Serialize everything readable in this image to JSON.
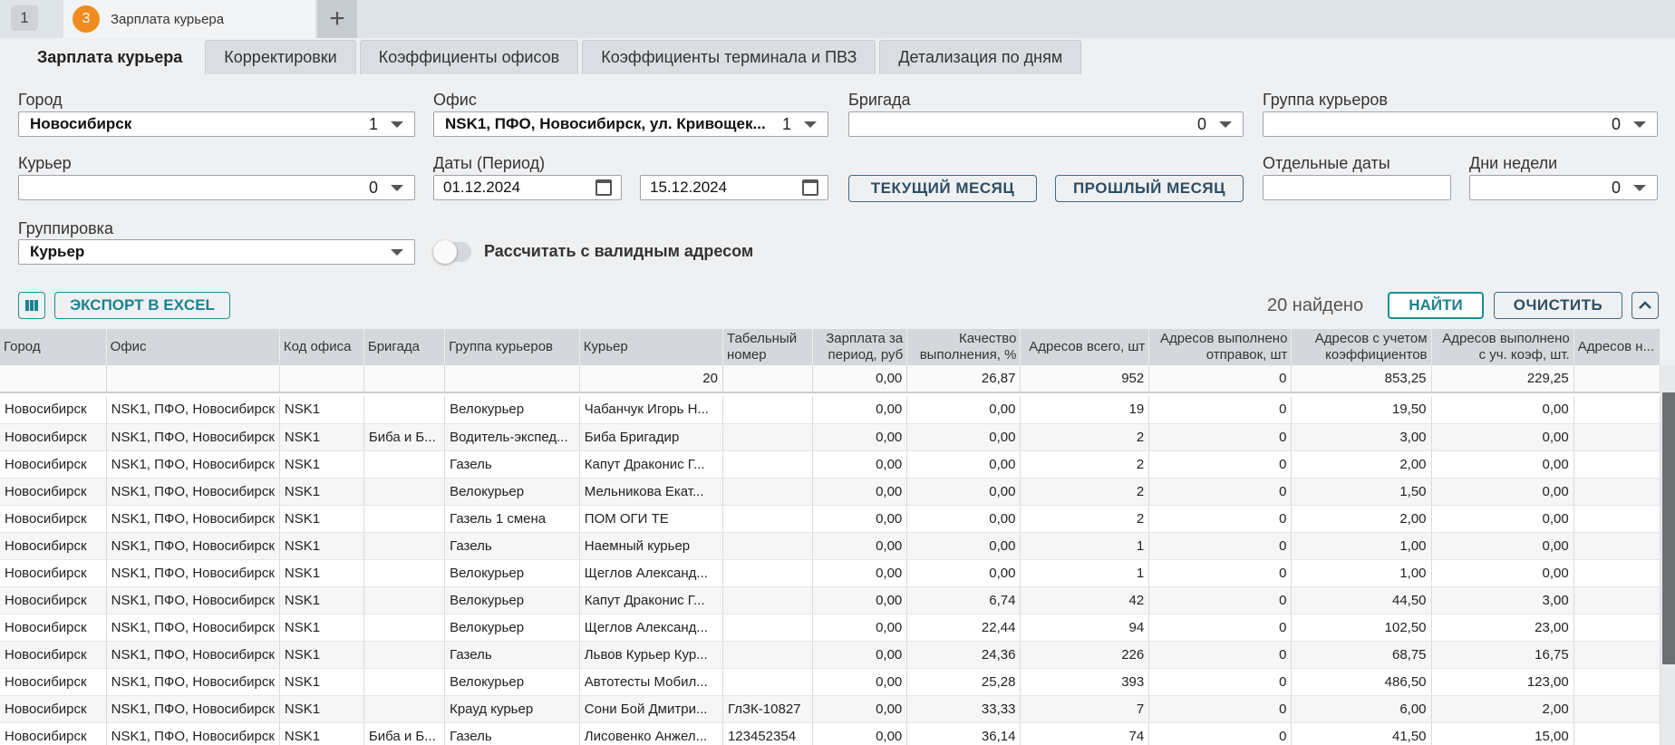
{
  "window_tabs": [
    {
      "label": "1"
    },
    {
      "badge": "3",
      "label": "Зарплата курьера"
    }
  ],
  "add_tab_label": "+",
  "sub_tabs": [
    "Зарплата курьера",
    "Корректировки",
    "Коэффициенты офисов",
    "Коэффициенты терминала и ПВЗ",
    "Детализация по дням"
  ],
  "filters": {
    "city": {
      "label": "Город",
      "value": "Новосибирск",
      "count": "1"
    },
    "office": {
      "label": "Офис",
      "value": "NSK1, ПФО, Новосибирск, ул. Кривощек...",
      "count": "1"
    },
    "brigade": {
      "label": "Бригада",
      "value": "",
      "count": "0"
    },
    "courier_group": {
      "label": "Группа курьеров",
      "value": "",
      "count": "0"
    },
    "courier": {
      "label": "Курьер",
      "value": "",
      "count": "0"
    },
    "dates": {
      "label": "Даты (Период)",
      "from": "01.12.2024",
      "to": "15.12.2024"
    },
    "current_month": "ТЕКУЩИЙ МЕСЯЦ",
    "last_month": "ПРОШЛЫЙ МЕСЯЦ",
    "separate_dates": {
      "label": "Отдельные даты",
      "value": ""
    },
    "weekdays": {
      "label": "Дни недели",
      "count": "0"
    },
    "grouping": {
      "label": "Группировка",
      "value": "Курьер"
    },
    "valid_address": {
      "label": "Рассчитать с валидным адресом",
      "on": false
    }
  },
  "toolbar": {
    "columns_icon": "columns-icon",
    "export": "ЭКСПОРТ В EXCEL",
    "found": "20 найдено",
    "find": "НАЙТИ",
    "clear": "ОЧИСТИТЬ",
    "collapse_icon": "chevron-up-icon"
  },
  "table": {
    "headers": [
      "Город",
      "Офис",
      "Код офиса",
      "Бригада",
      "Группа курьеров",
      "Курьер",
      "Табельный номер",
      "Зарплата за период, руб",
      "Качество выполнения, %",
      "Адресов всего, шт",
      "Адресов выполнено отправок, шт",
      "Адресов с учетом коэффициентов",
      "Адресов выполнено с уч. коэф, шт.",
      "Адресов н..."
    ],
    "total": [
      "",
      "",
      "",
      "",
      "",
      "20",
      "",
      "0,00",
      "26,87",
      "952",
      "0",
      "853,25",
      "229,25",
      ""
    ],
    "rows": [
      [
        "Новосибирск",
        "NSK1, ПФО, Новосибирск",
        "NSK1",
        "",
        "Велокурьер",
        "Чабанчук Игорь Н...",
        "",
        "0,00",
        "0,00",
        "19",
        "0",
        "19,50",
        "0,00",
        ""
      ],
      [
        "Новосибирск",
        "NSK1, ПФО, Новосибирск",
        "NSK1",
        "Биба и Б...",
        "Водитель-экспед...",
        "Биба Бригадир",
        "",
        "0,00",
        "0,00",
        "2",
        "0",
        "3,00",
        "0,00",
        ""
      ],
      [
        "Новосибирск",
        "NSK1, ПФО, Новосибирск",
        "NSK1",
        "",
        "Газель",
        "Капут Драконис Г...",
        "",
        "0,00",
        "0,00",
        "2",
        "0",
        "2,00",
        "0,00",
        ""
      ],
      [
        "Новосибирск",
        "NSK1, ПФО, Новосибирск",
        "NSK1",
        "",
        "Велокурьер",
        "Мельникова Екат...",
        "",
        "0,00",
        "0,00",
        "2",
        "0",
        "1,50",
        "0,00",
        ""
      ],
      [
        "Новосибирск",
        "NSK1, ПФО, Новосибирск",
        "NSK1",
        "",
        "Газель 1 смена",
        "ПОМ ОГИ ТЕ",
        "",
        "0,00",
        "0,00",
        "2",
        "0",
        "2,00",
        "0,00",
        ""
      ],
      [
        "Новосибирск",
        "NSK1, ПФО, Новосибирск",
        "NSK1",
        "",
        "Газель",
        "Наемный курьер",
        "",
        "0,00",
        "0,00",
        "1",
        "0",
        "1,00",
        "0,00",
        ""
      ],
      [
        "Новосибирск",
        "NSK1, ПФО, Новосибирск",
        "NSK1",
        "",
        "Велокурьер",
        "Щеглов Александ...",
        "",
        "0,00",
        "0,00",
        "1",
        "0",
        "1,00",
        "0,00",
        ""
      ],
      [
        "Новосибирск",
        "NSK1, ПФО, Новосибирск",
        "NSK1",
        "",
        "Велокурьер",
        "Капут Драконис Г...",
        "",
        "0,00",
        "6,74",
        "42",
        "0",
        "44,50",
        "3,00",
        ""
      ],
      [
        "Новосибирск",
        "NSK1, ПФО, Новосибирск",
        "NSK1",
        "",
        "Велокурьер",
        "Щеглов Александ...",
        "",
        "0,00",
        "22,44",
        "94",
        "0",
        "102,50",
        "23,00",
        ""
      ],
      [
        "Новосибирск",
        "NSK1, ПФО, Новосибирск",
        "NSK1",
        "",
        "Газель",
        "Львов Курьер Кур...",
        "",
        "0,00",
        "24,36",
        "226",
        "0",
        "68,75",
        "16,75",
        ""
      ],
      [
        "Новосибирск",
        "NSK1, ПФО, Новосибирск",
        "NSK1",
        "",
        "Велокурьер",
        "Автотесты Мобил...",
        "",
        "0,00",
        "25,28",
        "393",
        "0",
        "486,50",
        "123,00",
        ""
      ],
      [
        "Новосибирск",
        "NSK1, ПФО, Новосибирск",
        "NSK1",
        "",
        "Крауд курьер",
        "Сони Бой Дмитри...",
        "ГлЗК-10827",
        "0,00",
        "33,33",
        "7",
        "0",
        "6,00",
        "2,00",
        ""
      ],
      [
        "Новосибирск",
        "NSK1, ПФО, Новосибирск",
        "NSK1",
        "Биба и Б...",
        "Газель",
        "Лисовенко Анжел...",
        "123452354",
        "0,00",
        "36,14",
        "74",
        "0",
        "41,50",
        "15,00",
        ""
      ]
    ]
  }
}
